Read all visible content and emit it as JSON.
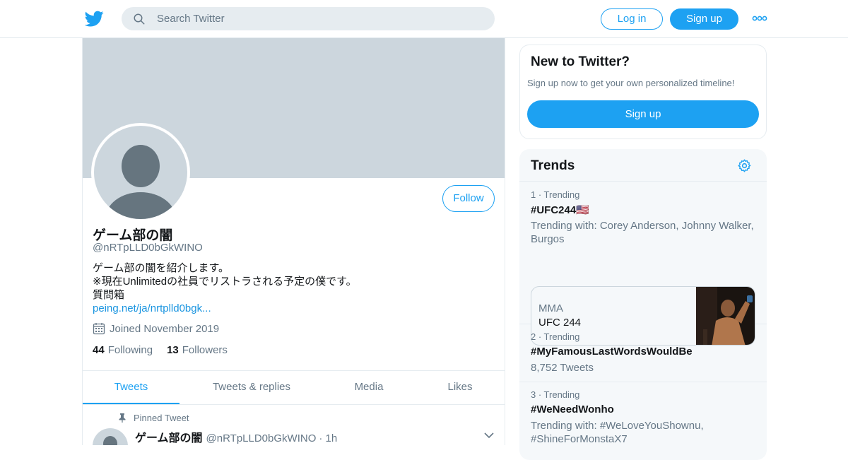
{
  "header": {
    "search_placeholder": "Search Twitter",
    "login_label": "Log in",
    "signup_label": "Sign up",
    "accent": "#1da1f2"
  },
  "profile": {
    "follow_label": "Follow",
    "display_name": "ゲーム部の闇",
    "handle": "@nRTpLLD0bGkWINO",
    "bio_lines": [
      "ゲーム部の闇を紹介します。",
      "※現在Unlimitedの社員でリストラされる予定の僕です。",
      "質問箱"
    ],
    "bio_link": "peing.net/ja/nrtplld0bgk...",
    "joined": "Joined November 2019",
    "following_count": "44",
    "following_label": "Following",
    "followers_count": "13",
    "followers_label": "Followers"
  },
  "tabs": [
    "Tweets",
    "Tweets & replies",
    "Media",
    "Likes"
  ],
  "active_tab": "Tweets",
  "pinned_tweet": {
    "label": "Pinned Tweet",
    "name": "ゲーム部の闇",
    "handle": "@nRTpLLD0bGkWINO",
    "time": "· 1h"
  },
  "new_to_twitter": {
    "title": "New to Twitter?",
    "subtitle": "Sign up now to get your own personalized timeline!",
    "button": "Sign up"
  },
  "trends": {
    "title": "Trends",
    "items": [
      {
        "meta": "1 · Trending",
        "name": "#UFC244🇺🇸",
        "desc": "Trending with: Corey Anderson, Johnny Walker, Burgos"
      },
      {
        "meta": "2 · Trending",
        "name": "#MyFamousLastWordsWouldBe",
        "desc": "8,752 Tweets"
      },
      {
        "meta": "3 · Trending",
        "name": "#WeNeedWonho",
        "desc": "Trending with: #WeLoveYouShownu, #ShineForMonstaX7"
      }
    ],
    "card": {
      "category": "MMA",
      "title": "UFC 244"
    }
  }
}
